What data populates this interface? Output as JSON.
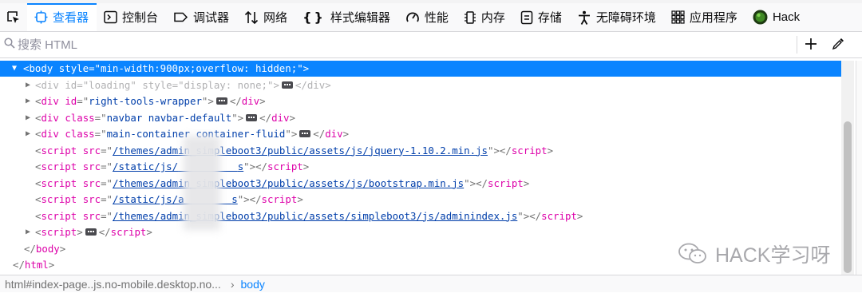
{
  "toolbar": {
    "tabs": [
      {
        "label": "查看器",
        "icon": "inspector-icon",
        "active": true
      },
      {
        "label": "控制台",
        "icon": "console-icon"
      },
      {
        "label": "调试器",
        "icon": "debugger-icon"
      },
      {
        "label": "网络",
        "icon": "network-icon"
      },
      {
        "label": "样式编辑器",
        "icon": "style-editor-icon"
      },
      {
        "label": "性能",
        "icon": "performance-icon"
      },
      {
        "label": "内存",
        "icon": "memory-icon"
      },
      {
        "label": "存储",
        "icon": "storage-icon"
      },
      {
        "label": "无障碍环境",
        "icon": "accessibility-icon"
      },
      {
        "label": "应用程序",
        "icon": "application-icon"
      },
      {
        "label": "Hack",
        "icon": "hackbar-icon"
      }
    ]
  },
  "search": {
    "placeholder": "搜索 HTML"
  },
  "tree": {
    "body_tag": "body",
    "body_attr": "style",
    "body_value": "min-width:900px;overflow: hidden;",
    "div_loading_id": "loading",
    "div_loading_style": "display: none;",
    "div_right_tools_id": "right-tools-wrapper",
    "div_navbar_class": "navbar navbar-default",
    "div_main_class": "main-container container-fluid",
    "script1_src": "/themes/admin_simpleboot3/public/assets/js/jquery-1.10.2.min.js",
    "script2_src_a": "/static/js/",
    "script2_src_b": "s",
    "script3_src": "/themes/admin_simpleboot3/public/assets/js/bootstrap.min.js",
    "script4_src_a": "/static/js/a",
    "script4_src_b": "s",
    "script5_src": "/themes/admin_simpleboot3/public/assets/simpleboot3/js/adminindex.js",
    "script_tag": "script",
    "close_body": "body",
    "close_html": "html"
  },
  "breadcrumbs": {
    "first": "html#index-page..js.no-mobile.desktop.no...",
    "current": "body"
  },
  "watermark": {
    "text": "HACK学习呀"
  },
  "colors": {
    "accent": "#0a84ff",
    "tag": "#dd00a9",
    "value": "#003eaa"
  }
}
